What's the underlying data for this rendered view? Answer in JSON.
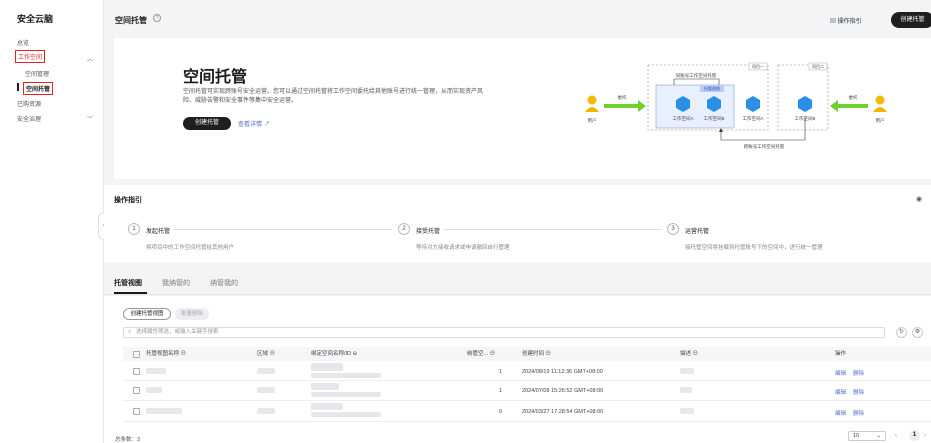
{
  "sidebar": {
    "title": "安全云脑",
    "items": [
      {
        "label": "总览"
      },
      {
        "label": "工作空间"
      },
      {
        "label": "空间管理"
      },
      {
        "label": "空间托管"
      },
      {
        "label": "已购资源"
      },
      {
        "label": "安全治理"
      }
    ]
  },
  "header": {
    "title": "空间托管",
    "guide_label": "操作指引",
    "create_label": "创建托管"
  },
  "hero": {
    "title": "空间托管",
    "desc": "空间托管可实现跨账号安全运营。您可以通过空间托管将工作空间委托给其他账号进行统一管理，从而实现资产风险、威胁告警和安全事件等集中安全运营。",
    "create_label": "创建托管",
    "link_label": "查看详情",
    "diagram": {
      "project1": "项目一",
      "project2": "项目二",
      "same_account": "同账号工作空间托管",
      "cross_account": "跨账号工作空间托管",
      "hosted_view": "托管视图",
      "delegate1": "委托",
      "delegate2": "委托",
      "user_left": "用户",
      "user_right": "用户",
      "ws_a": "工作空间A",
      "ws_b": "工作空间B",
      "ws_c": "工作空间A",
      "ws_d": "工作空间B"
    }
  },
  "guide": {
    "title": "操作指引",
    "steps": [
      {
        "num": "1",
        "title": "发起托管",
        "desc": "将项目中的工作空间托管给其他用户"
      },
      {
        "num": "2",
        "title": "接受托管",
        "desc": "等待对方接收请求或申请撤回自行管理"
      },
      {
        "num": "3",
        "title": "运营托管",
        "desc": "接托管空间将挂载到托管账号下的空间中，进行统一管理"
      }
    ]
  },
  "tabs": [
    {
      "label": "托管视图"
    },
    {
      "label": "我纳管的"
    },
    {
      "label": "纳管我的"
    }
  ],
  "table": {
    "create_view_label": "创建托管视图",
    "batch_delete_label": "批量删除",
    "search_placeholder": "选择属性筛选，或输入关键字搜索",
    "columns": [
      "托管视图名称 ⊖",
      "区域 ⊖",
      "绑定空间名称/ID ⊖",
      "纳管空... ⊖",
      "创建时间 ⊖",
      "描述 ⊖",
      "操作"
    ],
    "rows": [
      {
        "count": "1",
        "time": "2024/08/19 11:12:36 GMT+08:00",
        "edit": "编辑",
        "delete": "删除"
      },
      {
        "count": "1",
        "time": "2024/07/08 15:26:52 GMT+08:00",
        "edit": "编辑",
        "delete": "删除"
      },
      {
        "count": "0",
        "time": "2024/03/27 17:28:54 GMT+08:00",
        "edit": "编辑",
        "delete": "删除"
      }
    ],
    "total": "总条数：3",
    "page_size": "10",
    "current_page": "1"
  }
}
